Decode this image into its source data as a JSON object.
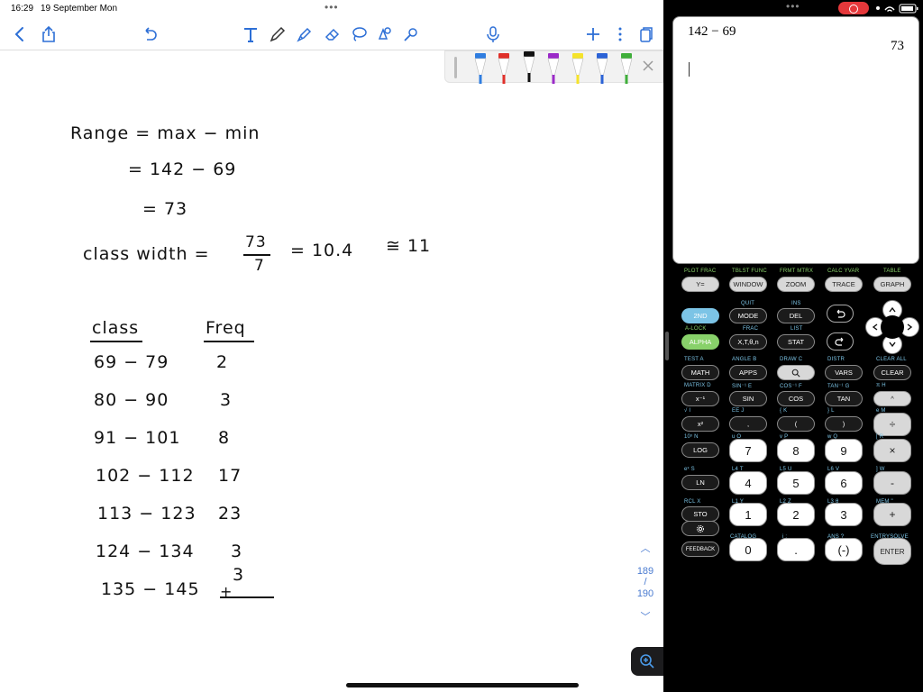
{
  "status": {
    "time": "16:29",
    "date": "19 September Mon"
  },
  "notes": {
    "lines": {
      "range": "Range = max − min",
      "range2": "= 142 − 69",
      "range3": "= 73",
      "classwidth": "class width =",
      "num": "73",
      "den": "7",
      "cw_val": "= 10.4",
      "approx": "≅ 11",
      "col_class": "class",
      "col_freq": "Freq"
    },
    "table": [
      {
        "cls": "69 − 79",
        "freq": "2"
      },
      {
        "cls": "80 − 90",
        "freq": "3"
      },
      {
        "cls": "91 − 101",
        "freq": "8"
      },
      {
        "cls": "102 − 112",
        "freq": "17"
      },
      {
        "cls": "113 − 123",
        "freq": "23"
      },
      {
        "cls": "124 − 134",
        "freq": "3"
      },
      {
        "cls": "135 − 145",
        "freq": "3"
      }
    ],
    "page_top": "189",
    "page_bottom": "190"
  },
  "pens": [
    {
      "name": "blue",
      "color": "#2f7de0"
    },
    {
      "name": "red",
      "color": "#e0302a"
    },
    {
      "name": "black",
      "color": "#111111"
    },
    {
      "name": "purple",
      "color": "#9b2ac8"
    },
    {
      "name": "yellow",
      "color": "#f5e32a"
    },
    {
      "name": "blue-2",
      "color": "#2b62d6"
    },
    {
      "name": "green",
      "color": "#3fae3a"
    }
  ],
  "calculator": {
    "expression": "142 − 69",
    "result": "73",
    "top_labels": [
      "PLOT FRAC",
      "TBLST FUNC",
      "FRMT MTRX",
      "CALC YVAR",
      "TABLE"
    ],
    "top_keys": [
      "Y=",
      "WINDOW",
      "ZOOM",
      "TRACE",
      "GRAPH"
    ],
    "row2": {
      "quit": "QUIT",
      "ins": "INS",
      "second": "2ND",
      "mode": "MODE",
      "del": "DEL"
    },
    "row3": {
      "alock": "A-LOCK",
      "frac": "FRAC",
      "list": "LIST",
      "alpha": "ALPHA",
      "xtn": "X,T,θ,n",
      "stat": "STAT"
    },
    "row4": {
      "labels": [
        "TEST   A",
        "ANGLE   B",
        "DRAW   C",
        "DISTR",
        "CLEAR ALL"
      ],
      "keys": [
        "MATH",
        "APPS",
        "VARS",
        "CLEAR"
      ]
    },
    "row5": {
      "labels": [
        "MATRIX   D",
        "SIN⁻¹   E",
        "COS⁻¹   F",
        "TAN⁻¹   G",
        "π   H"
      ],
      "keys": [
        "x⁻¹",
        "SIN",
        "COS",
        "TAN",
        "^"
      ]
    },
    "row6": {
      "labels": [
        "√   I",
        "EE   J",
        "{   K",
        "}   L",
        "e   M"
      ],
      "keys": [
        "x²",
        ",",
        "(",
        ")",
        "÷"
      ]
    },
    "row7": {
      "labels": [
        "10ˣ   N",
        "u   O",
        "v   P",
        "w   Q",
        "[   R"
      ],
      "keys": [
        "LOG",
        "7",
        "8",
        "9",
        "×"
      ]
    },
    "row8": {
      "labels": [
        "eˣ   S",
        "L4   T",
        "L5   U",
        "L6   V",
        "]   W"
      ],
      "keys": [
        "LN",
        "4",
        "5",
        "6",
        "-"
      ]
    },
    "row9": {
      "labels": [
        "RCL   X",
        "L1   Y",
        "L2   Z",
        "L3   θ",
        "MEM   \""
      ],
      "keys": [
        "STO",
        "1",
        "2",
        "3",
        "+"
      ]
    },
    "row10": {
      "labels": [
        "CATALOG",
        "i   :",
        "ANS   ?",
        "ENTRYSOLVE"
      ],
      "keys": [
        "FEEDBACK",
        "0",
        ".",
        "(-)",
        "ENTER"
      ]
    }
  }
}
